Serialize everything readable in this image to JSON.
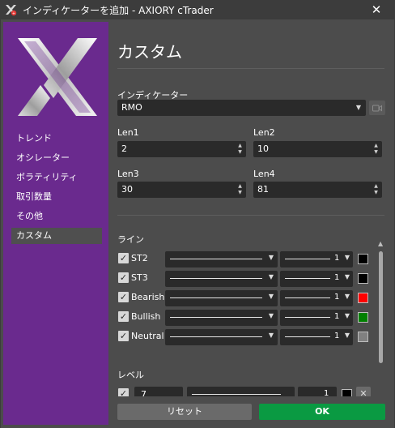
{
  "window": {
    "title": "インディケーターを追加 - AXIORY cTrader",
    "close_glyph": "✕"
  },
  "colors": {
    "sidebar": "#6a2a8e",
    "ok_button": "#0a9a42",
    "background": "#4c4c4c"
  },
  "sidebar": {
    "logo_icon": "x-logo-icon",
    "items": [
      {
        "label": "トレンド"
      },
      {
        "label": "オシレーター"
      },
      {
        "label": "ボラティリティ"
      },
      {
        "label": "取引数量"
      },
      {
        "label": "その他"
      },
      {
        "label": "カスタム",
        "active": true
      }
    ]
  },
  "main": {
    "title": "カスタム",
    "indicator": {
      "label": "インディケーター",
      "value": "RMO"
    },
    "params": [
      {
        "label": "Len1",
        "value": "2"
      },
      {
        "label": "Len2",
        "value": "10"
      },
      {
        "label": "Len3",
        "value": "30"
      },
      {
        "label": "Len4",
        "value": "81"
      }
    ],
    "lines_section": {
      "label": "ライン"
    },
    "lines": [
      {
        "name": "ST2",
        "checked": true,
        "width": "1",
        "color": "#000000"
      },
      {
        "name": "ST3",
        "checked": true,
        "width": "1",
        "color": "#000000"
      },
      {
        "name": "Bearish",
        "checked": true,
        "width": "1",
        "color": "#ff0000"
      },
      {
        "name": "Bullish",
        "checked": true,
        "width": "1",
        "color": "#008000"
      },
      {
        "name": "Neutral",
        "checked": true,
        "width": "1",
        "color": "#808080"
      }
    ],
    "levels_section": {
      "label": "レベル"
    },
    "levels": [
      {
        "value": "7",
        "width": "1",
        "color": "#000000"
      }
    ]
  },
  "footer": {
    "reset_label": "リセット",
    "ok_label": "OK"
  }
}
